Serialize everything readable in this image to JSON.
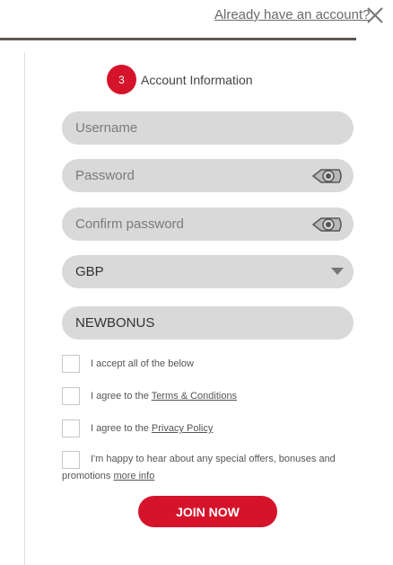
{
  "header": {
    "login_link": "Already have an account?",
    "close_icon": "close-x-icon"
  },
  "step": {
    "number": "3",
    "title": "Account Information"
  },
  "fields": {
    "username_placeholder": "Username",
    "password_placeholder": "Password",
    "confirm_password_placeholder": "Confirm password",
    "password_toggle_icon": "eye-icon",
    "currency_value": "GBP",
    "promo_code_value": "NEWBONUS"
  },
  "consents": {
    "accept_all": "I accept all of the below",
    "terms_prefix": "I agree to the",
    "terms_link": "Terms & Conditions",
    "privacy_prefix": "I agree to the",
    "privacy_link": "Privacy Policy",
    "offers_text": "I'm happy to hear about any special offers, bonuses and promotions",
    "offers_link": "more info"
  },
  "actions": {
    "join_label": "JOIN NOW"
  },
  "colors": {
    "accent": "#d5142b",
    "field_bg": "#d9d9d9",
    "divider": "#5d5952"
  }
}
